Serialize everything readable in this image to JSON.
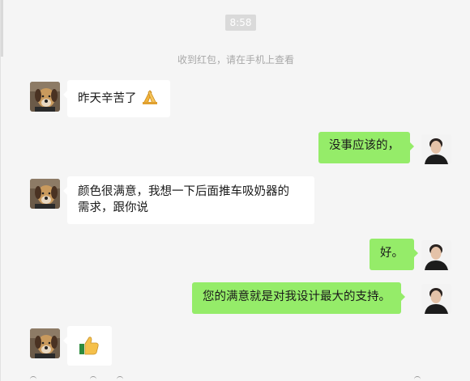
{
  "chat": {
    "time_stamp": "8:58",
    "system_notice": "收到红包，请在手机上查看",
    "messages": [
      {
        "sender": "other",
        "text": "昨天辛苦了",
        "emoji": "folded-hands-icon"
      },
      {
        "sender": "me",
        "text": "没事应该的，"
      },
      {
        "sender": "other",
        "text_line1": "颜色很满意，我想一下后面推车吸奶器的",
        "text_line2": "需求，跟你说"
      },
      {
        "sender": "me",
        "text": "好。"
      },
      {
        "sender": "me",
        "text": "您的满意就是对我设计最大的支持。"
      },
      {
        "sender": "other",
        "emoji": "thumbs-up-icon"
      }
    ]
  },
  "colors": {
    "background": "#f5f5f5",
    "incoming_bubble": "#ffffff",
    "outgoing_bubble": "#95ec69",
    "timestamp_bg": "#dadada",
    "system_text": "#a8a8a8"
  }
}
